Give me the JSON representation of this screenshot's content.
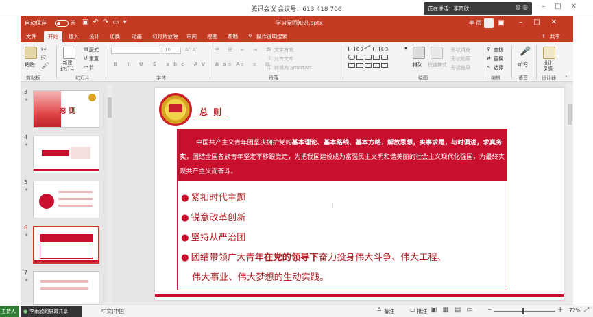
{
  "meeting": {
    "title": "腾讯会议 会议号：613 418 706",
    "speaking_label": "正在讲话：李雨欣",
    "host_tag": "主持人",
    "share_tag": "李雨欣的屏幕共享"
  },
  "ppt": {
    "autosave_label": "自动保存",
    "autosave_state": "关",
    "file_name": "学习党团知识.pptx",
    "user_name": "李 雨",
    "share_label": "共享",
    "tabs": [
      "文件",
      "开始",
      "插入",
      "设计",
      "切换",
      "动画",
      "幻灯片放映",
      "审阅",
      "视图",
      "帮助",
      "操作说明搜索"
    ],
    "active_tab": "开始",
    "ribbon": {
      "paste": "粘贴",
      "new_slide": "新建\n幻灯片",
      "layout": "版式",
      "reset": "重置",
      "section": "节",
      "font_size": "10",
      "text_direction": "文字方向",
      "align_text": "对齐文本",
      "convert_smartart": "转换为 SmartArt",
      "arrange": "排列",
      "quick_styles": "快速样式",
      "shape_fill": "形状填充",
      "shape_outline": "形状轮廓",
      "shape_effects": "形状效果",
      "find": "查找",
      "replace": "替换",
      "select": "选择",
      "dictate": "听写",
      "designer": "设计\n灵感",
      "groups": {
        "clipboard": "剪贴板",
        "slides": "幻灯片",
        "font": "字体",
        "paragraph": "段落",
        "drawing": "绘图",
        "editing": "编辑",
        "voice": "语音",
        "designer": "设计器"
      }
    },
    "thumbnails": [
      {
        "num": "3",
        "title": "总 则"
      },
      {
        "num": "4",
        "title": ""
      },
      {
        "num": "5",
        "title": ""
      },
      {
        "num": "6",
        "title": "",
        "selected": true
      },
      {
        "num": "7",
        "title": ""
      }
    ],
    "status": {
      "language": "中文(中国)",
      "notes": "备注",
      "comments": "批注",
      "zoom": "72%"
    }
  },
  "slide": {
    "title": "总 则",
    "intro_parts": [
      {
        "text": "中国共产主义青年团坚决拥护党的",
        "bold": false
      },
      {
        "text": "基本理论、基本路线、基本方略",
        "bold": true
      },
      {
        "text": "，",
        "bold": false
      },
      {
        "text": "解放思想，实事求是，与时俱进，求真务实",
        "bold": true
      },
      {
        "text": "，团结全国各族青年坚定不移跟党走，为把我国建设成为富强民主文明和谐美丽的社会主义现代化强国，为最终实现共产主义而奋斗。",
        "bold": false
      }
    ],
    "bullets": [
      {
        "text": "紧扣时代主题"
      },
      {
        "text": "锐意改革创新"
      },
      {
        "text": "坚持从严治团"
      },
      {
        "pre": "团结带领广大青年",
        "bold": "在党的领导下",
        "post": "奋力投身伟大斗争、伟大工程、"
      },
      {
        "continuation": "伟大事业、伟大梦想的生动实践。"
      }
    ]
  },
  "colors": {
    "ppt_red": "#c33b22",
    "slide_red": "#c8102e",
    "title_red": "#b21d23"
  }
}
